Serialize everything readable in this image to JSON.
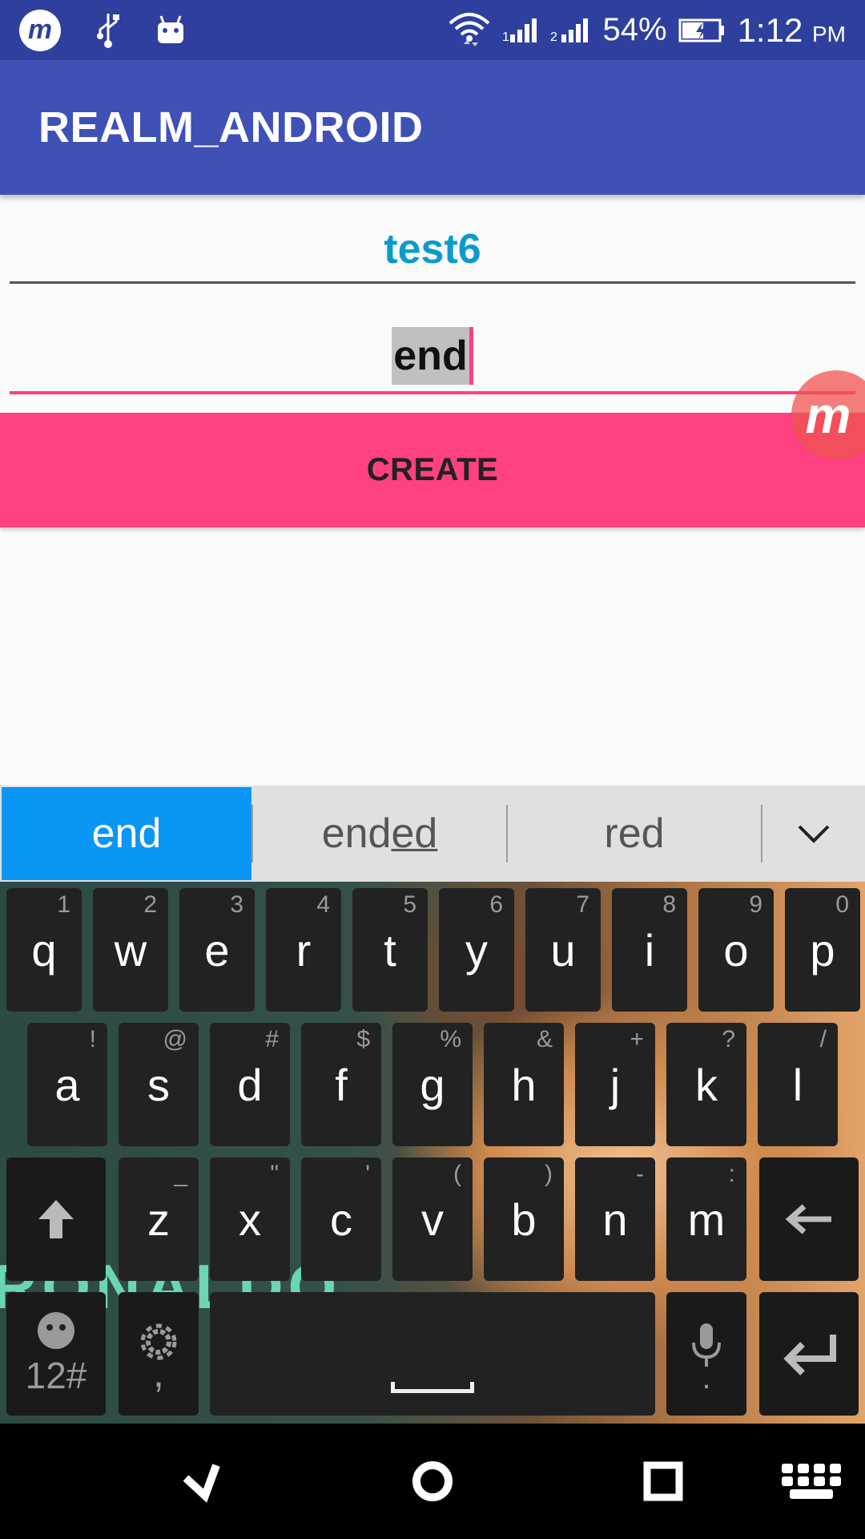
{
  "status_bar": {
    "battery": "54%",
    "time": "1:12",
    "ampm": "PM",
    "icons": [
      "app-logo-icon",
      "usb-icon",
      "android-debug-icon",
      "wifi-icon",
      "signal-1-icon",
      "signal-2-icon",
      "battery-charging-icon"
    ]
  },
  "app_bar": {
    "title": "REALM_ANDROID"
  },
  "form": {
    "field1_value": "test6",
    "field2_value": "end",
    "create_label": "CREATE"
  },
  "suggestions": {
    "items": [
      "end",
      "end",
      "ed",
      "red"
    ],
    "more_icon": "chevron-down-icon"
  },
  "keyboard": {
    "row1": [
      {
        "k": "q",
        "h": "1"
      },
      {
        "k": "w",
        "h": "2"
      },
      {
        "k": "e",
        "h": "3"
      },
      {
        "k": "r",
        "h": "4"
      },
      {
        "k": "t",
        "h": "5"
      },
      {
        "k": "y",
        "h": "6"
      },
      {
        "k": "u",
        "h": "7"
      },
      {
        "k": "i",
        "h": "8"
      },
      {
        "k": "o",
        "h": "9"
      },
      {
        "k": "p",
        "h": "0"
      }
    ],
    "row2": [
      {
        "k": "a",
        "h": "!"
      },
      {
        "k": "s",
        "h": "@"
      },
      {
        "k": "d",
        "h": "#"
      },
      {
        "k": "f",
        "h": "$"
      },
      {
        "k": "g",
        "h": "%"
      },
      {
        "k": "h",
        "h": "&"
      },
      {
        "k": "j",
        "h": "+"
      },
      {
        "k": "k",
        "h": "?"
      },
      {
        "k": "l",
        "h": "/"
      }
    ],
    "row3": [
      {
        "k": "z",
        "h": "_"
      },
      {
        "k": "x",
        "h": "\""
      },
      {
        "k": "c",
        "h": "'"
      },
      {
        "k": "v",
        "h": "("
      },
      {
        "k": "b",
        "h": ")"
      },
      {
        "k": "n",
        "h": "-"
      },
      {
        "k": "m",
        "h": ":"
      }
    ],
    "sym_label": "12#",
    "comma": ",",
    "mic_dot": ".",
    "background_text": "RONALDO"
  },
  "nav_bar": {
    "icons": [
      "back-icon",
      "home-icon",
      "recents-icon",
      "keyboard-icon"
    ]
  }
}
